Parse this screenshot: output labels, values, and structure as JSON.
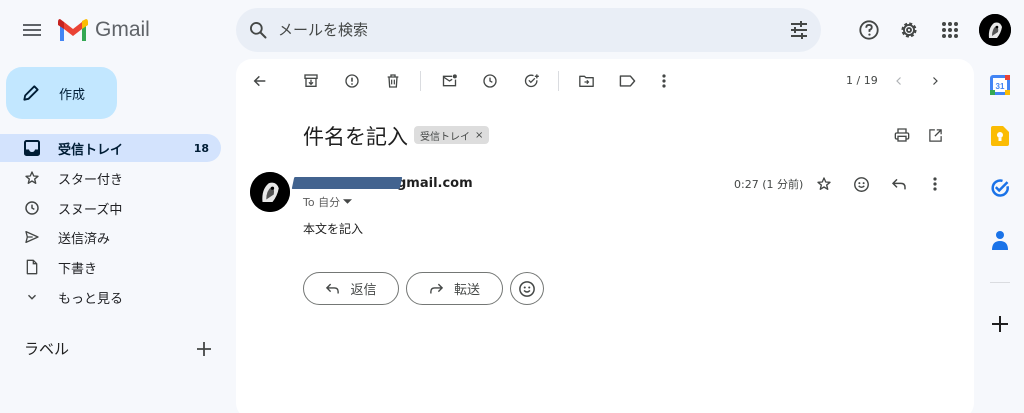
{
  "app": {
    "name": "Gmail"
  },
  "search": {
    "placeholder": "メールを検索"
  },
  "compose": {
    "label": "作成"
  },
  "nav": {
    "items": [
      {
        "label": "受信トレイ",
        "count": "18",
        "icon": "inbox-icon",
        "active": true
      },
      {
        "label": "スター付き",
        "icon": "star-icon"
      },
      {
        "label": "スヌーズ中",
        "icon": "clock-icon"
      },
      {
        "label": "送信済み",
        "icon": "send-icon"
      },
      {
        "label": "下書き",
        "icon": "draft-icon"
      },
      {
        "label": "もっと見る",
        "icon": "chevron-down-icon"
      }
    ],
    "labels_title": "ラベル"
  },
  "toolbar": {
    "pager": "1 / 19"
  },
  "message": {
    "subject": "件名を記入",
    "label_chip": "受信トレイ",
    "label_chip_close": "×",
    "sender_email": "gmail.com",
    "to_line": "To 自分",
    "time": "0:27 (1 分前)",
    "body": "本文を記入"
  },
  "actions": {
    "reply": "返信",
    "forward": "転送"
  },
  "side_panel": {
    "calendar_day": "31"
  },
  "colors": {
    "background": "#f6f8fc",
    "compose_bg": "#c2e7ff",
    "active_nav": "#d3e3fd",
    "search_bg": "#e9eef6",
    "redaction": "#42638f"
  }
}
